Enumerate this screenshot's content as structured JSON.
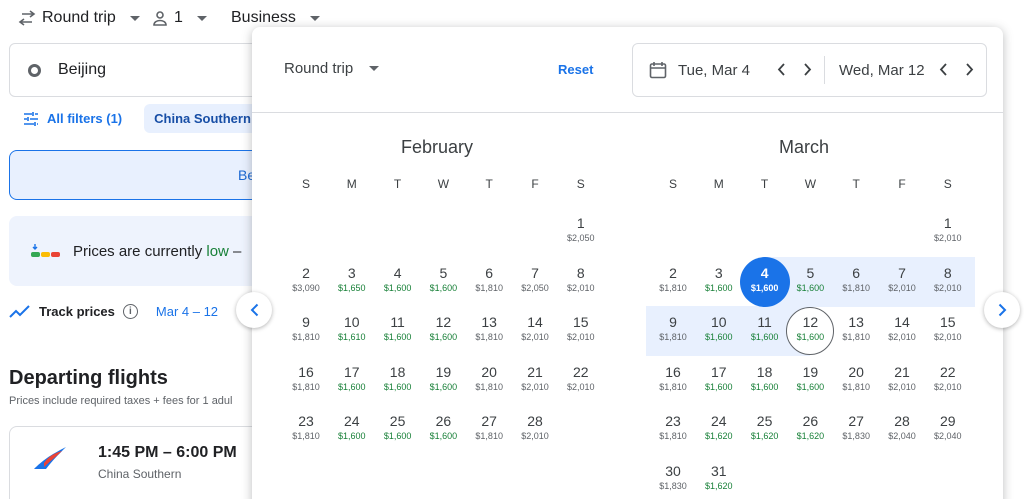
{
  "toolbar": {
    "trip_type": "Round trip",
    "passengers": "1",
    "cabin": "Business"
  },
  "search": {
    "origin": "Beijing"
  },
  "filters": {
    "all_filters": "All filters (1)",
    "airline_chip": "China Southern"
  },
  "tabs": {
    "best_partial": "Be"
  },
  "insight": {
    "prefix": "Prices are currently ",
    "level": "low",
    "suffix": " –"
  },
  "track": {
    "label": "Track prices",
    "dates": "Mar 4 – 12"
  },
  "departing": {
    "title": "Departing flights",
    "subtitle": "Prices include required taxes + fees for 1 adul"
  },
  "flight": {
    "time": "1:45 PM – 6:00 PM",
    "airline": "China Southern"
  },
  "picker": {
    "trip_type": "Round trip",
    "reset": "Reset",
    "depart_date": "Tue, Mar 4",
    "return_date": "Wed, Mar 12"
  },
  "colors": {
    "accent": "#1a73e8",
    "low_price": "#188038",
    "range": "#e8f0fe"
  },
  "weekdays": [
    "S",
    "M",
    "T",
    "W",
    "T",
    "F",
    "S"
  ],
  "months": [
    {
      "name": "February",
      "first_weekday": 6,
      "days": [
        {
          "d": "1",
          "p": "$2,050",
          "low": false
        },
        {
          "d": "2",
          "p": "$3,090",
          "low": false
        },
        {
          "d": "3",
          "p": "$1,650",
          "low": true
        },
        {
          "d": "4",
          "p": "$1,600",
          "low": true
        },
        {
          "d": "5",
          "p": "$1,600",
          "low": true
        },
        {
          "d": "6",
          "p": "$1,810",
          "low": false
        },
        {
          "d": "7",
          "p": "$2,050",
          "low": false
        },
        {
          "d": "8",
          "p": "$2,010",
          "low": false
        },
        {
          "d": "9",
          "p": "$1,810",
          "low": false
        },
        {
          "d": "10",
          "p": "$1,610",
          "low": true
        },
        {
          "d": "11",
          "p": "$1,600",
          "low": true
        },
        {
          "d": "12",
          "p": "$1,600",
          "low": true
        },
        {
          "d": "13",
          "p": "$1,810",
          "low": false
        },
        {
          "d": "14",
          "p": "$2,010",
          "low": false
        },
        {
          "d": "15",
          "p": "$2,010",
          "low": false
        },
        {
          "d": "16",
          "p": "$1,810",
          "low": false
        },
        {
          "d": "17",
          "p": "$1,600",
          "low": true
        },
        {
          "d": "18",
          "p": "$1,600",
          "low": true
        },
        {
          "d": "19",
          "p": "$1,600",
          "low": true
        },
        {
          "d": "20",
          "p": "$1,810",
          "low": false
        },
        {
          "d": "21",
          "p": "$2,010",
          "low": false
        },
        {
          "d": "22",
          "p": "$2,010",
          "low": false
        },
        {
          "d": "23",
          "p": "$1,810",
          "low": false
        },
        {
          "d": "24",
          "p": "$1,600",
          "low": true
        },
        {
          "d": "25",
          "p": "$1,600",
          "low": true
        },
        {
          "d": "26",
          "p": "$1,600",
          "low": true
        },
        {
          "d": "27",
          "p": "$1,810",
          "low": false
        },
        {
          "d": "28",
          "p": "$2,010",
          "low": false
        }
      ]
    },
    {
      "name": "March",
      "first_weekday": 6,
      "days": [
        {
          "d": "1",
          "p": "$2,010",
          "low": false
        },
        {
          "d": "2",
          "p": "$1,810",
          "low": false
        },
        {
          "d": "3",
          "p": "$1,600",
          "low": true
        },
        {
          "d": "4",
          "p": "$1,600",
          "low": true,
          "state": "selected"
        },
        {
          "d": "5",
          "p": "$1,600",
          "low": true,
          "state": "range"
        },
        {
          "d": "6",
          "p": "$1,810",
          "low": false,
          "state": "range"
        },
        {
          "d": "7",
          "p": "$2,010",
          "low": false,
          "state": "range"
        },
        {
          "d": "8",
          "p": "$2,010",
          "low": false,
          "state": "range"
        },
        {
          "d": "9",
          "p": "$1,810",
          "low": false,
          "state": "range"
        },
        {
          "d": "10",
          "p": "$1,600",
          "low": true,
          "state": "range"
        },
        {
          "d": "11",
          "p": "$1,600",
          "low": true,
          "state": "range"
        },
        {
          "d": "12",
          "p": "$1,600",
          "low": true,
          "state": "end"
        },
        {
          "d": "13",
          "p": "$1,810",
          "low": false
        },
        {
          "d": "14",
          "p": "$2,010",
          "low": false
        },
        {
          "d": "15",
          "p": "$2,010",
          "low": false
        },
        {
          "d": "16",
          "p": "$1,810",
          "low": false
        },
        {
          "d": "17",
          "p": "$1,600",
          "low": true
        },
        {
          "d": "18",
          "p": "$1,600",
          "low": true
        },
        {
          "d": "19",
          "p": "$1,600",
          "low": true
        },
        {
          "d": "20",
          "p": "$1,810",
          "low": false
        },
        {
          "d": "21",
          "p": "$2,010",
          "low": false
        },
        {
          "d": "22",
          "p": "$2,010",
          "low": false
        },
        {
          "d": "23",
          "p": "$1,810",
          "low": false
        },
        {
          "d": "24",
          "p": "$1,620",
          "low": true
        },
        {
          "d": "25",
          "p": "$1,620",
          "low": true
        },
        {
          "d": "26",
          "p": "$1,620",
          "low": true
        },
        {
          "d": "27",
          "p": "$1,830",
          "low": false
        },
        {
          "d": "28",
          "p": "$2,040",
          "low": false
        },
        {
          "d": "29",
          "p": "$2,040",
          "low": false
        },
        {
          "d": "30",
          "p": "$1,830",
          "low": false
        },
        {
          "d": "31",
          "p": "$1,620",
          "low": true
        }
      ]
    }
  ]
}
